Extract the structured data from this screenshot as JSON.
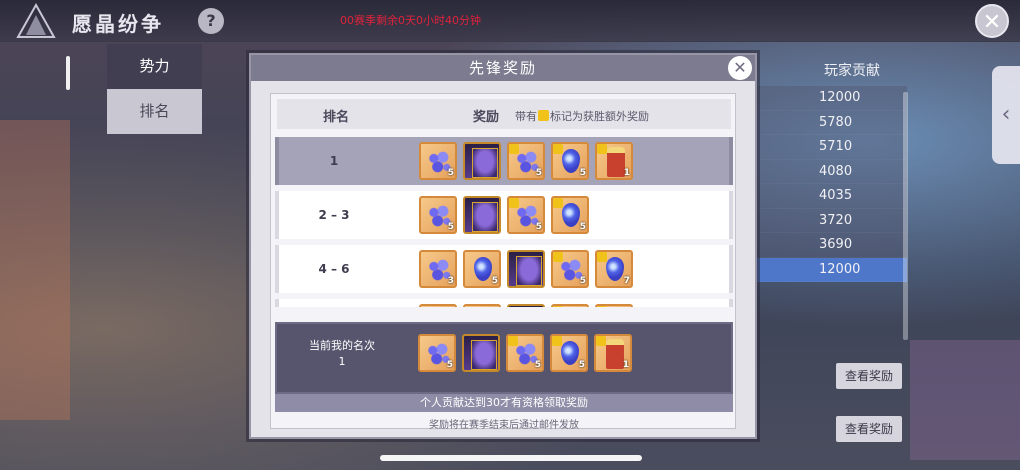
{
  "header": {
    "title": "愿晶纷争",
    "help_label": "?",
    "season_timer": "00赛季剩余0天0小时40分钟",
    "close_label": "✕"
  },
  "left_nav": {
    "items": [
      {
        "label": "势力",
        "active": false
      },
      {
        "label": "排名",
        "active": true
      }
    ]
  },
  "right_panel": {
    "header": "玩家贡献",
    "values": [
      "12000",
      "5780",
      "5710",
      "4080",
      "4035",
      "3720",
      "3690",
      "12000"
    ],
    "view_button_label": "查看奖励",
    "side_arrow": "‹"
  },
  "modal": {
    "title": "先锋奖励",
    "close_label": "✕",
    "col_rank": "排名",
    "col_reward": "奖励",
    "col_note_before": "带有",
    "col_note_after": "标记为获胜额外奖励",
    "rows": [
      {
        "rank": "1",
        "items": [
          {
            "type": "drops",
            "count": "5",
            "star": false
          },
          {
            "type": "portrait",
            "count": "",
            "star": false
          },
          {
            "type": "drops",
            "count": "5",
            "star": true
          },
          {
            "type": "drop",
            "count": "5",
            "star": true
          },
          {
            "type": "costume",
            "count": "1",
            "star": true
          }
        ]
      },
      {
        "rank": "2 – 3",
        "items": [
          {
            "type": "drops",
            "count": "5",
            "star": false
          },
          {
            "type": "portrait",
            "count": "",
            "star": false
          },
          {
            "type": "drops",
            "count": "5",
            "star": true
          },
          {
            "type": "drop",
            "count": "5",
            "star": true
          }
        ]
      },
      {
        "rank": "4 – 6",
        "items": [
          {
            "type": "drops",
            "count": "3",
            "star": false
          },
          {
            "type": "drop",
            "count": "5",
            "star": false
          },
          {
            "type": "portrait",
            "count": "",
            "star": false
          },
          {
            "type": "drops",
            "count": "5",
            "star": true
          },
          {
            "type": "drop",
            "count": "7",
            "star": true
          }
        ]
      },
      {
        "rank": "",
        "items": [
          {
            "type": "drops",
            "count": "",
            "star": false
          },
          {
            "type": "drop",
            "count": "",
            "star": false
          },
          {
            "type": "portrait",
            "count": "",
            "star": false
          },
          {
            "type": "drops",
            "count": "",
            "star": true
          },
          {
            "type": "drop",
            "count": "",
            "star": true
          }
        ]
      }
    ],
    "mine": {
      "label_line1": "当前我的名次",
      "label_line2": "1",
      "items": [
        {
          "type": "drops",
          "count": "5",
          "star": false
        },
        {
          "type": "portrait",
          "count": "",
          "star": false
        },
        {
          "type": "drops",
          "count": "5",
          "star": true
        },
        {
          "type": "drop",
          "count": "5",
          "star": true
        },
        {
          "type": "costume",
          "count": "1",
          "star": true
        }
      ]
    },
    "condition": "个人贡献达到30才有资格领取奖励",
    "footnote": "奖励将在赛季结束后通过邮件发放"
  },
  "colors": {
    "season_timer": "#e0223c",
    "highlight_row": "#4e77c9",
    "star_mark": "#f0c21a"
  }
}
